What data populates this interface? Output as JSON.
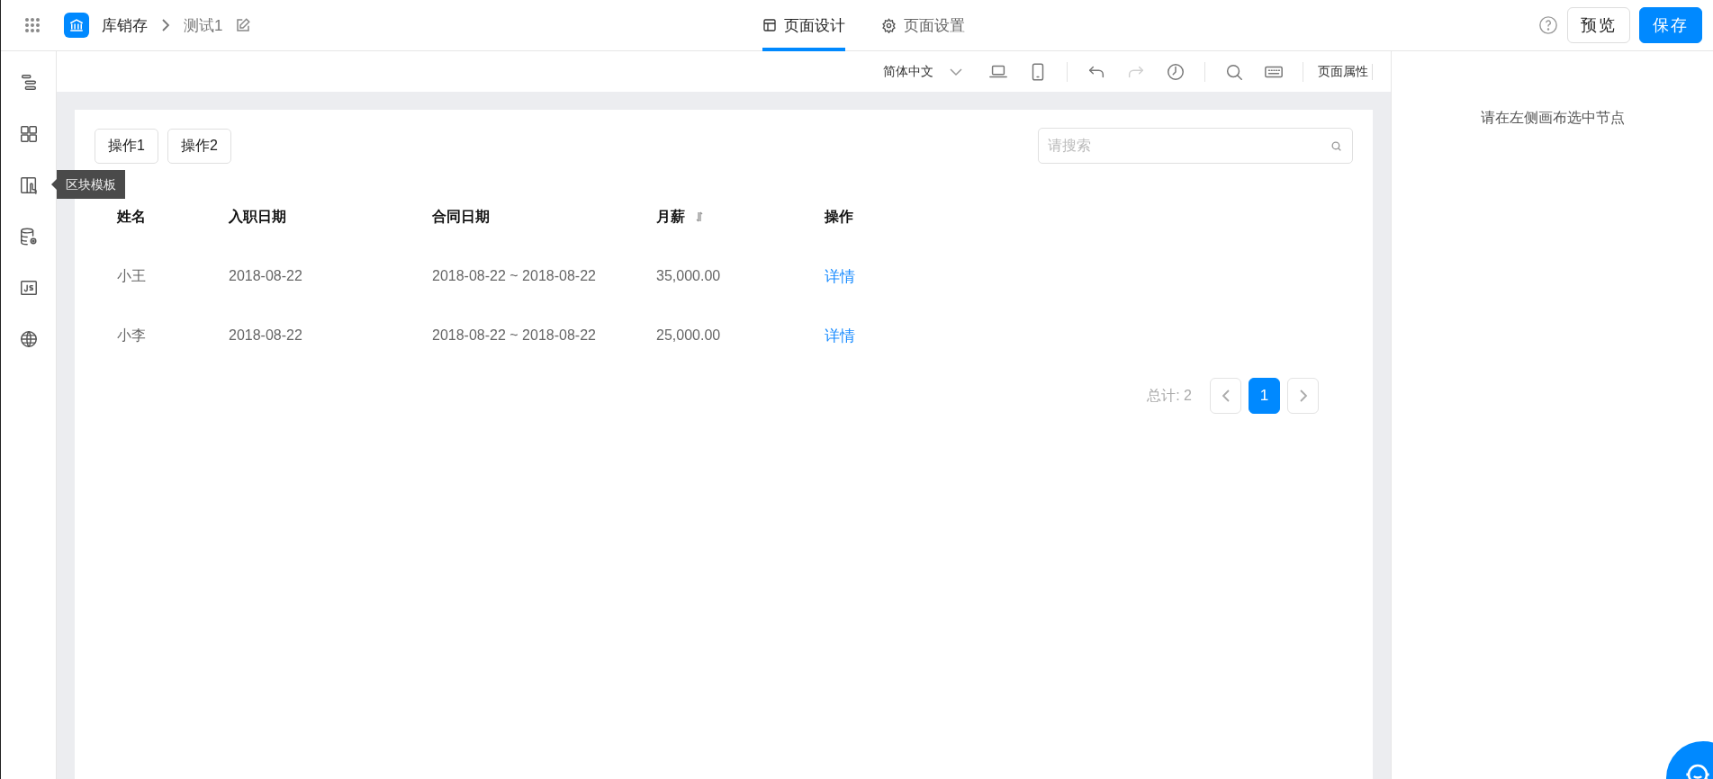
{
  "header": {
    "app_name": "库销存",
    "page_name": "测试1",
    "tabs": [
      {
        "label": "页面设计",
        "kind": "design",
        "selected": true
      },
      {
        "label": "页面设置",
        "kind": "settings",
        "selected": false
      }
    ],
    "buttons": [
      {
        "label": "预览",
        "kind": "default"
      },
      {
        "label": "保存",
        "kind": "primary"
      }
    ]
  },
  "sidebar": {
    "items": [
      {
        "kind": "outline"
      },
      {
        "kind": "components"
      },
      {
        "kind": "blocks",
        "tooltip": "区块模板"
      },
      {
        "kind": "datasource"
      },
      {
        "kind": "js"
      },
      {
        "kind": "globe"
      }
    ]
  },
  "toolbar": {
    "language": "简体中文",
    "tools": [
      {
        "kind": "desktop",
        "disabled": false
      },
      {
        "kind": "mobile",
        "disabled": false
      },
      {
        "kind": "undo",
        "disabled": false
      },
      {
        "kind": "redo",
        "disabled": true
      },
      {
        "kind": "history",
        "disabled": false
      },
      {
        "kind": "search",
        "disabled": false
      },
      {
        "kind": "keyboard",
        "disabled": false
      }
    ],
    "page_properties": "页面属性"
  },
  "canvas": {
    "actions": [
      "操作1",
      "操作2"
    ],
    "search": {
      "placeholder": "请搜索"
    },
    "table": {
      "columns": [
        {
          "label": "姓名",
          "sortable": false
        },
        {
          "label": "入职日期",
          "sortable": false
        },
        {
          "label": "合同日期",
          "sortable": false
        },
        {
          "label": "月薪",
          "sortable": true
        },
        {
          "label": "操作",
          "sortable": false
        }
      ],
      "rows": [
        {
          "name": "小王",
          "hire_date": "2018-08-22",
          "contract": "2018-08-22 ~ 2018-08-22",
          "salary": "35,000.00",
          "action": "详情"
        },
        {
          "name": "小李",
          "hire_date": "2018-08-22",
          "contract": "2018-08-22 ~ 2018-08-22",
          "salary": "25,000.00",
          "action": "详情"
        }
      ]
    },
    "pagination": {
      "total": "总计: 2",
      "pages": [
        {
          "label": "1",
          "selected": true
        }
      ]
    }
  },
  "right_panel": {
    "hint": "请在左侧画布选中节点"
  }
}
